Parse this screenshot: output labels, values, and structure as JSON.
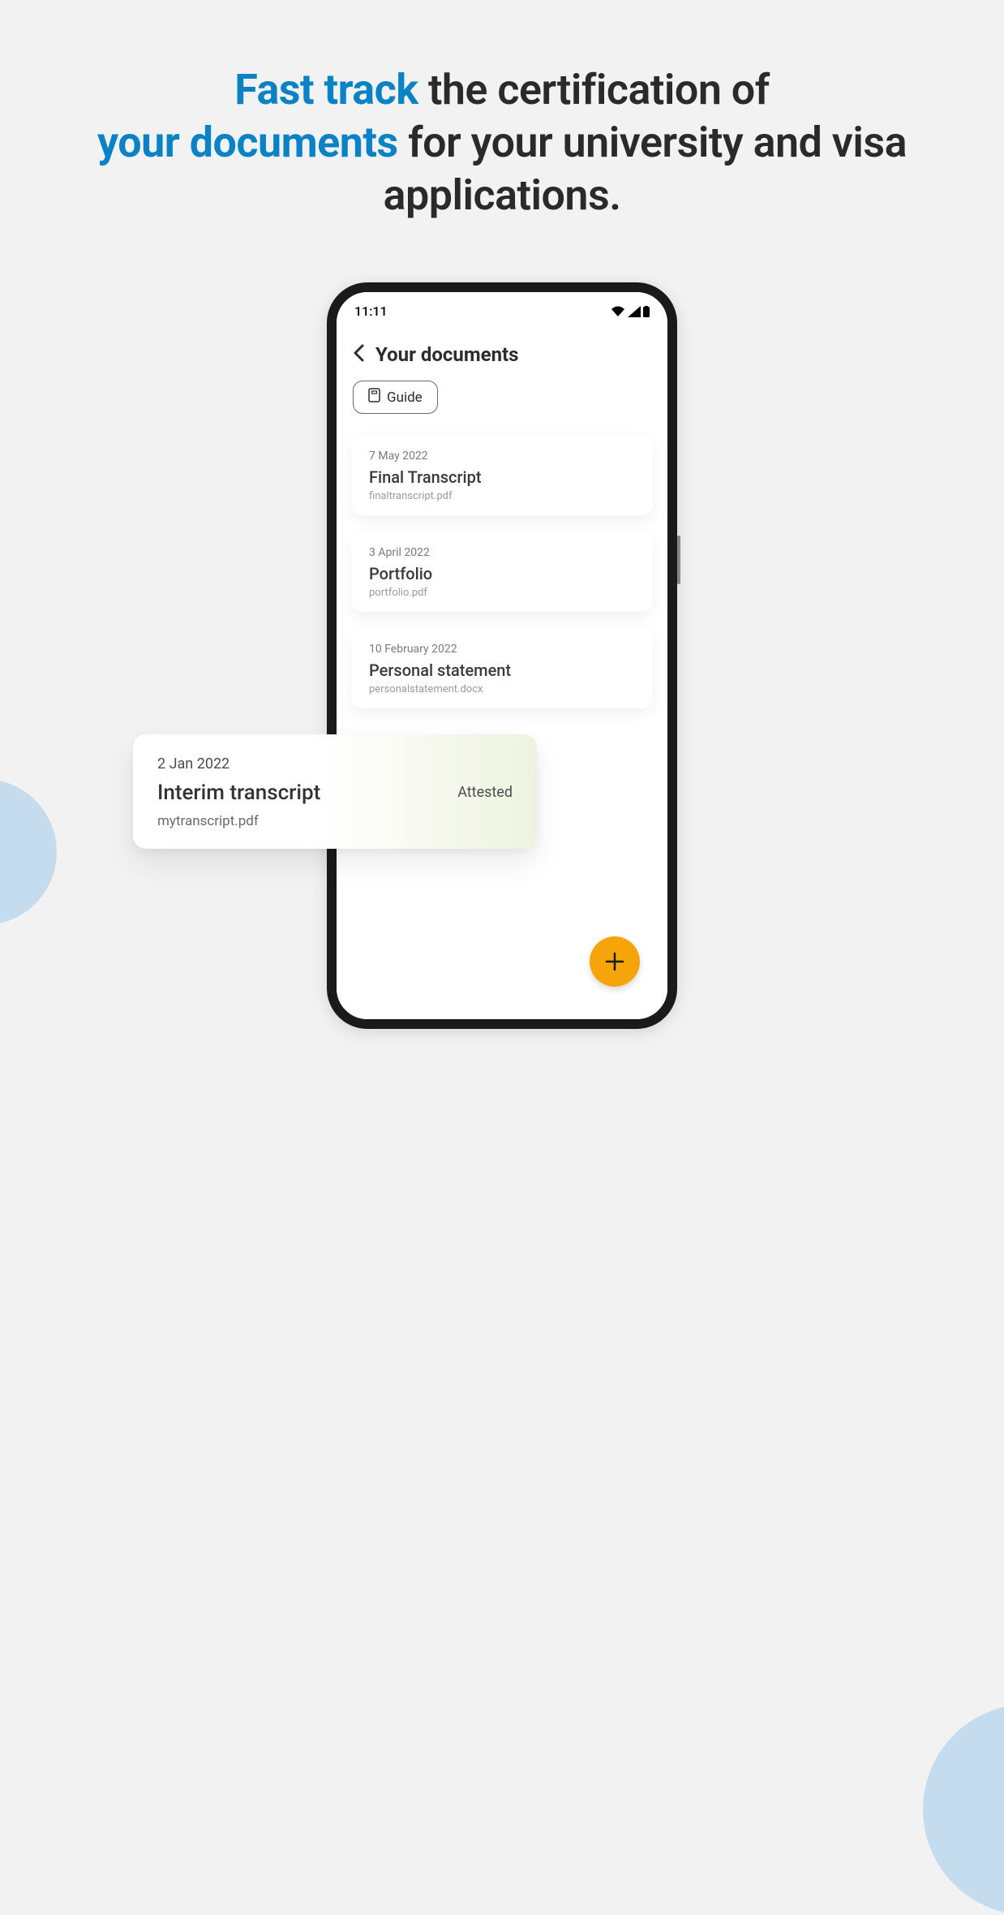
{
  "headline": {
    "seg1": "Fast track",
    "seg2": " the certification of ",
    "seg3": "your documents",
    "seg4": " for your university and visa applications."
  },
  "status": {
    "time": "11:11"
  },
  "screen": {
    "title": "Your documents",
    "guide_label": "Guide"
  },
  "documents": [
    {
      "date": "7 May 2022",
      "title": "Final Transcript",
      "file": "finaltranscript.pdf"
    },
    {
      "date": "3 April 2022",
      "title": "Portfolio",
      "file": "portfolio.pdf"
    },
    {
      "date": "10 February 2022",
      "title": "Personal statement",
      "file": "personalstatement.docx"
    }
  ],
  "popout": {
    "date": "2 Jan 2022",
    "title": "Interim transcript",
    "file": "mytranscript.pdf",
    "status": "Attested"
  }
}
